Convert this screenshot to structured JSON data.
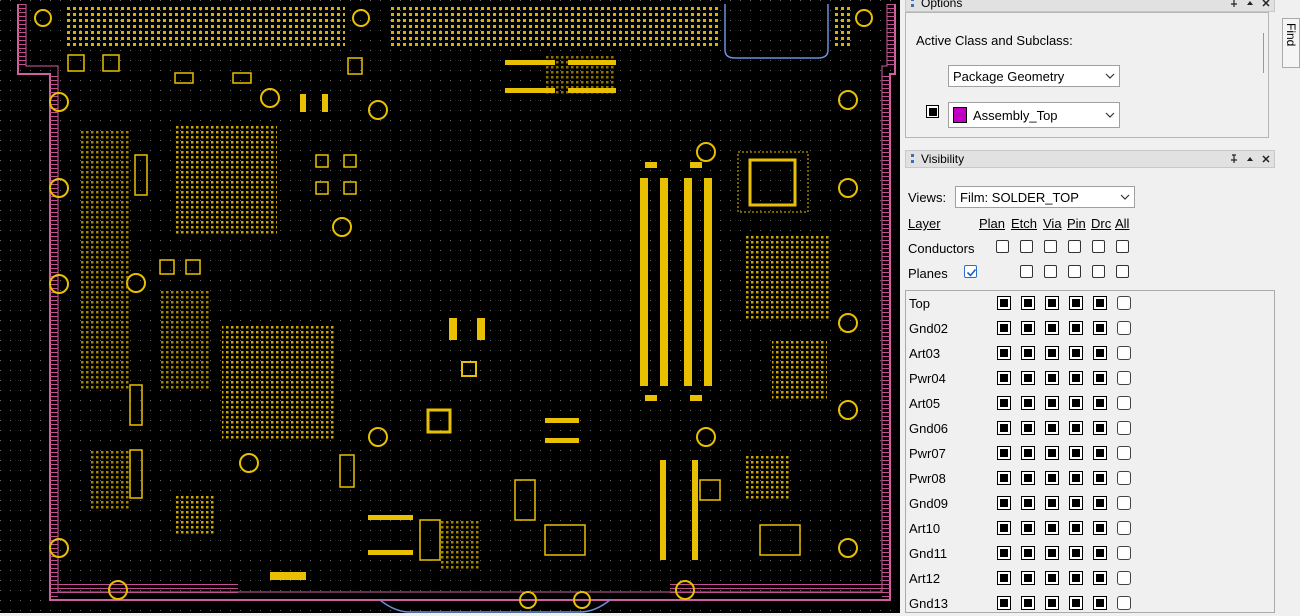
{
  "options_panel": {
    "title": "Options",
    "active_label": "Active Class and Subclass:",
    "class_value": "Package Geometry",
    "subclass_value": "Assembly_Top",
    "subclass_color": "#c000c0"
  },
  "visibility_panel": {
    "title": "Visibility",
    "views_label": "Views:",
    "views_value": "Film: SOLDER_TOP",
    "headers": [
      "Layer",
      "Plan",
      "Etch",
      "Via",
      "Pin",
      "Drc",
      "All"
    ],
    "conductors_label": "Conductors",
    "planes_label": "Planes",
    "planes_plan_checked": true,
    "layers": [
      "Top",
      "Gnd02",
      "Art03",
      "Pwr04",
      "Art05",
      "Gnd06",
      "Pwr07",
      "Pwr08",
      "Gnd09",
      "Art10",
      "Gnd11",
      "Art12",
      "Gnd13"
    ]
  },
  "find_tab": {
    "label": "Find"
  },
  "colors": {
    "board_outline": "#d060a0",
    "copper": "#e8c000",
    "canvas": "#000000"
  }
}
